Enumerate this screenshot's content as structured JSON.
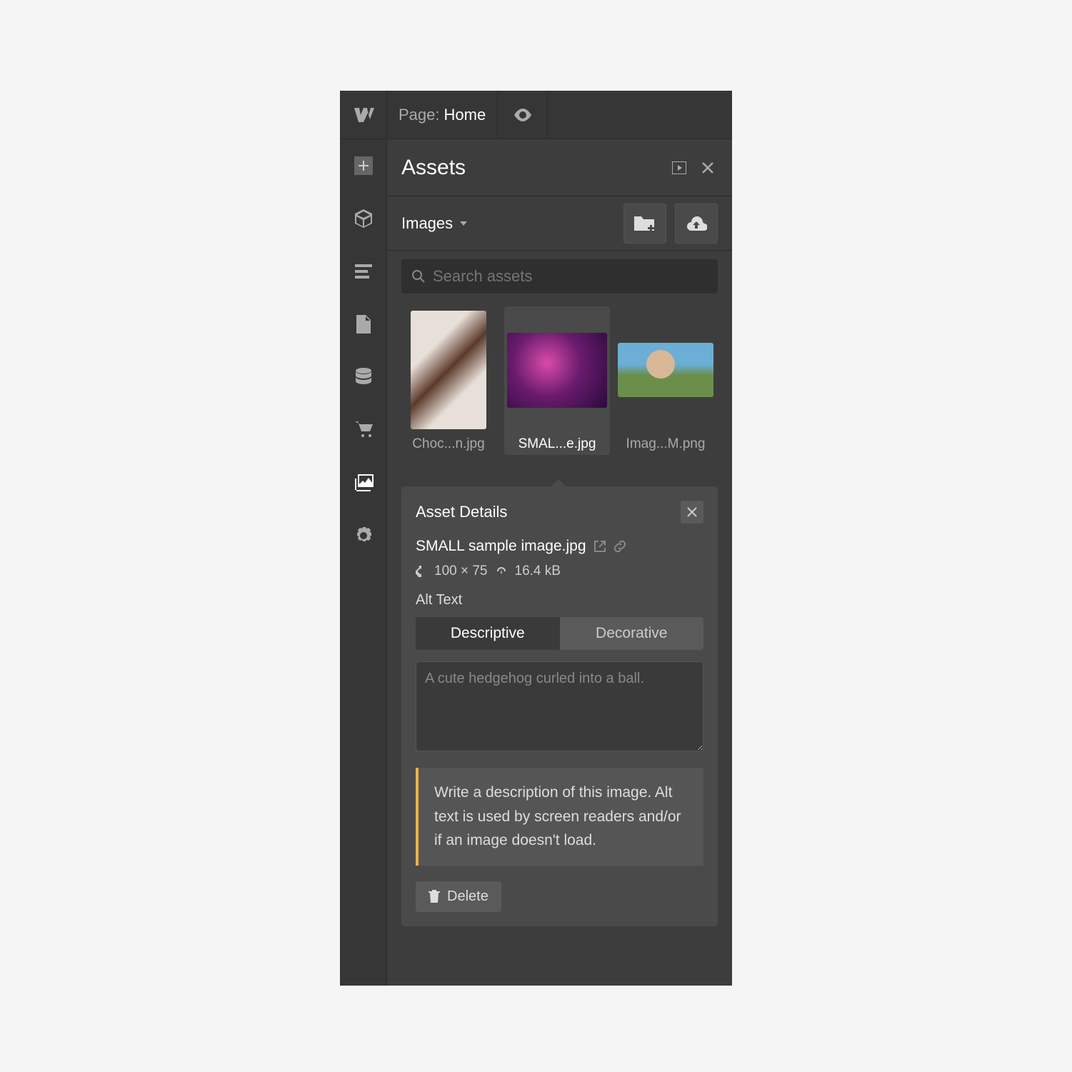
{
  "topbar": {
    "page_label": "Page:",
    "page_name": "Home"
  },
  "panel": {
    "title": "Assets",
    "filter": "Images",
    "search_placeholder": "Search assets"
  },
  "assets": [
    {
      "name": "Choc...n.jpg"
    },
    {
      "name": "SMAL...e.jpg"
    },
    {
      "name": "Imag...M.png"
    }
  ],
  "details": {
    "title": "Asset Details",
    "filename": "SMALL sample image.jpg",
    "dimensions": "100 × 75",
    "filesize": "16.4 kB",
    "alt_label": "Alt Text",
    "tab_descriptive": "Descriptive",
    "tab_decorative": "Decorative",
    "alt_placeholder": "A cute hedgehog curled into a ball.",
    "hint": "Write a description of this image. Alt text is used by screen readers and/or if an image doesn't load.",
    "delete_label": "Delete"
  }
}
